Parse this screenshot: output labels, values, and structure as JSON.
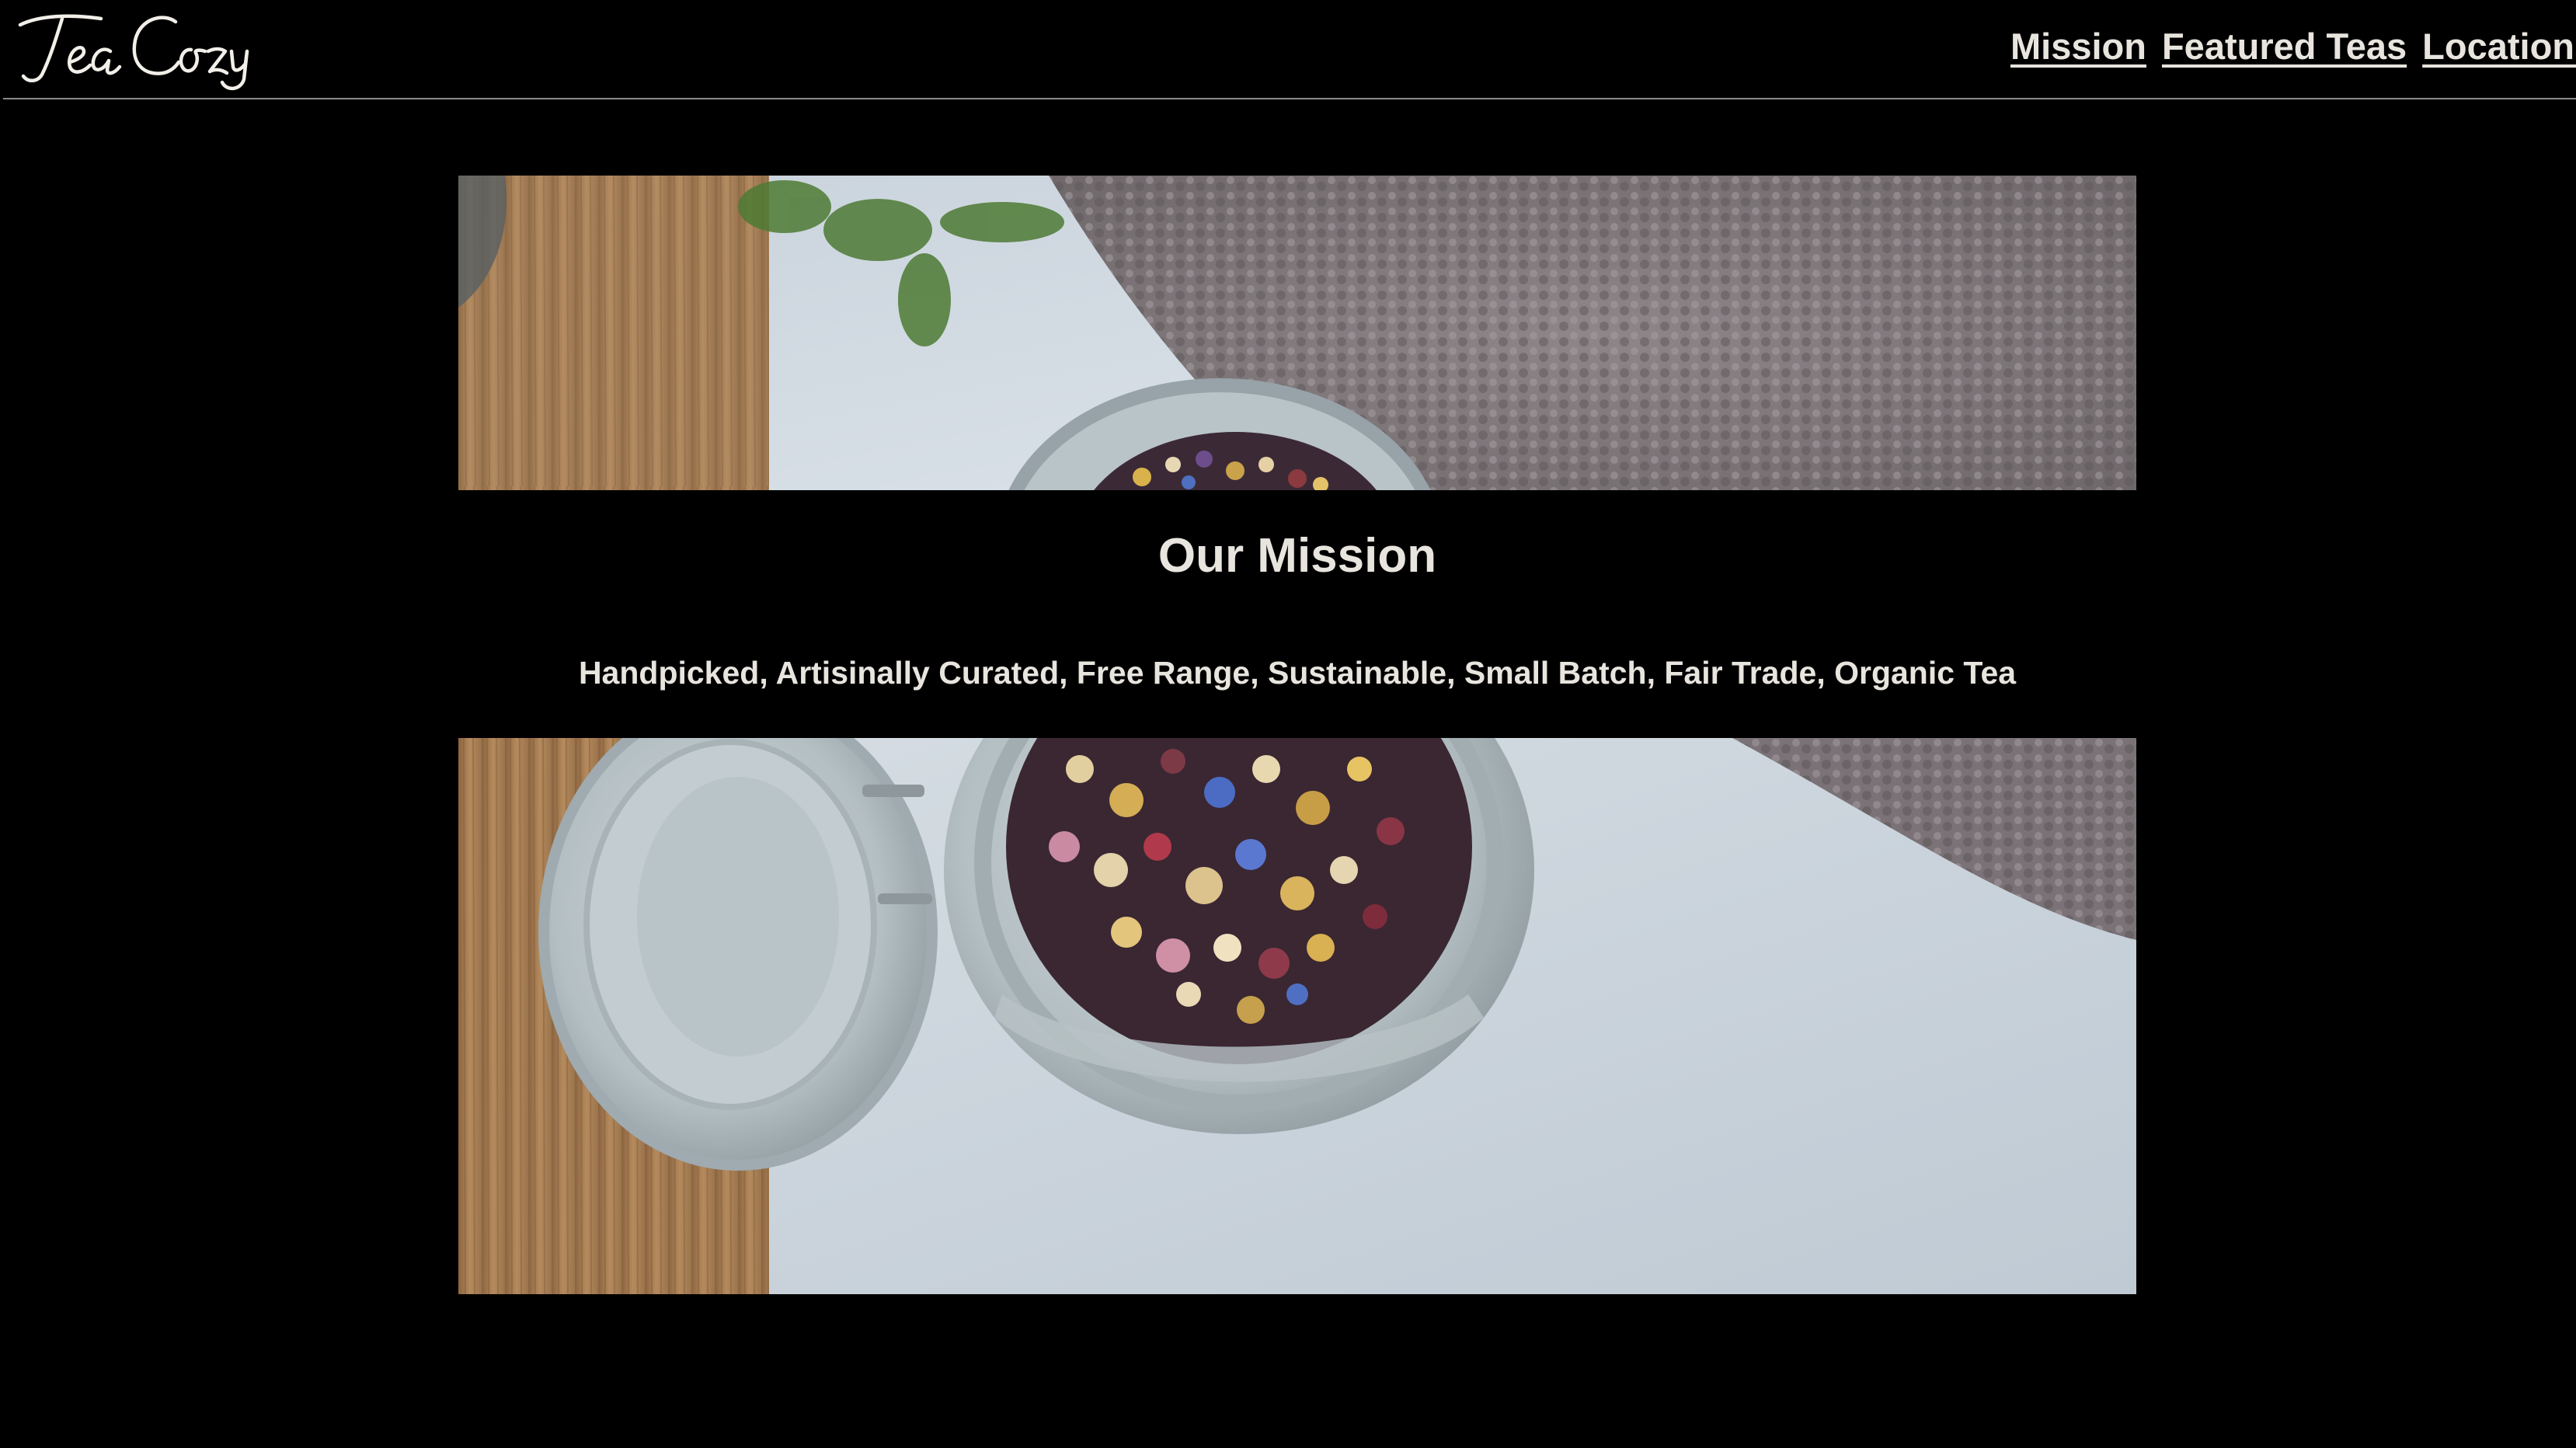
{
  "brand": {
    "logo_text": "Tea Cozy"
  },
  "nav": {
    "items": [
      {
        "label": "Mission"
      },
      {
        "label": "Featured Teas"
      },
      {
        "label": "Locations"
      }
    ]
  },
  "mission": {
    "title": "Our Mission",
    "tagline": "Handpicked, Artisinally Curated, Free Range, Sustainable, Small Batch, Fair Trade, Organic Tea"
  },
  "colors": {
    "background": "#000000",
    "text": "#e8e4de",
    "header_rule": "#8a8a8a"
  }
}
